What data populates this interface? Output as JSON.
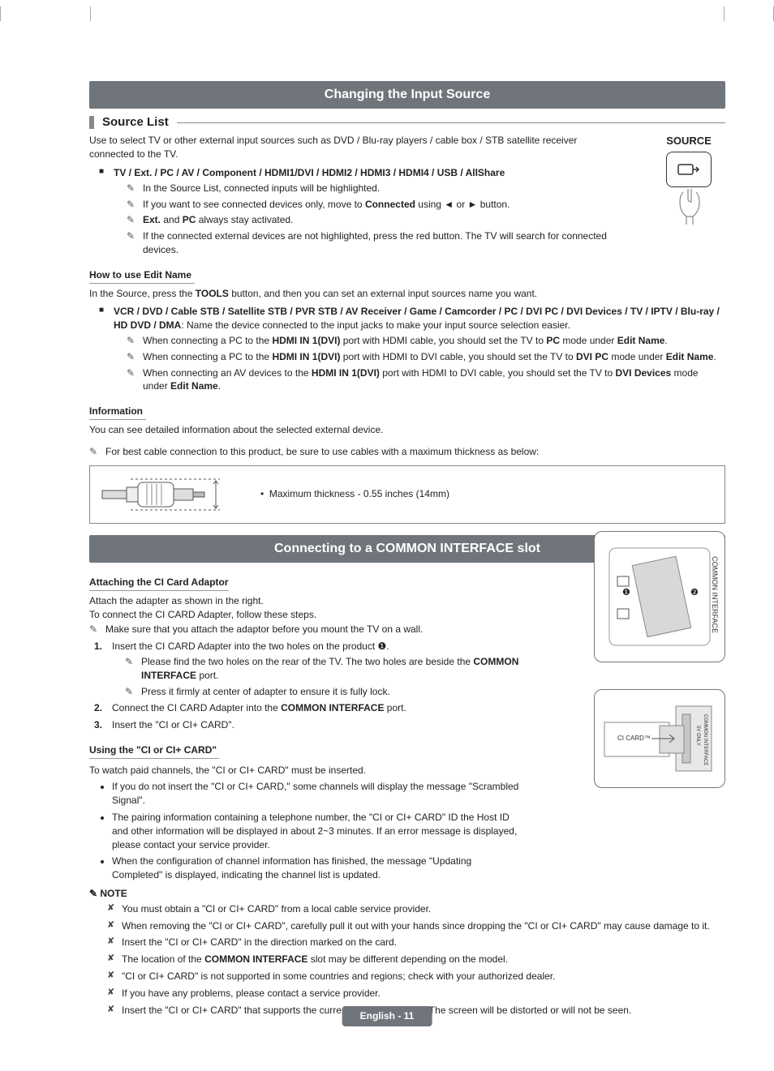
{
  "section1": {
    "bar": "Changing the Input Source",
    "subhead": "Source List",
    "intro": "Use to select TV or other external input sources such as DVD / Blu-ray players / cable box / STB satellite receiver connected to the TV.",
    "sourceLabel": "SOURCE",
    "inputs_line": "TV / Ext. / PC / AV / Component / HDMI1/DVI / HDMI2 / HDMI3 / HDMI4 / USB / AllShare",
    "notes": {
      "n1": "In the Source List, connected inputs will be highlighted.",
      "n2a": "If you want to see connected devices only, move to ",
      "n2b": "Connected",
      "n2c": " using ◄ or ► button.",
      "n3a": "Ext.",
      "n3b": " and ",
      "n3c": "PC",
      "n3d": " always stay activated.",
      "n4": "If the connected external devices are not highlighted, press the red button. The TV will search for connected devices."
    },
    "edit_head": "How to use Edit Name",
    "edit_intro_a": "In the Source, press the ",
    "edit_intro_b": "TOOLS",
    "edit_intro_c": " button, and then you can set an external input sources name you want.",
    "edit_devices_a": "VCR / DVD / Cable STB / Satellite STB / PVR STB / AV Receiver / Game / Camcorder / PC / DVI PC / DVI Devices / TV / IPTV / Blu-ray / HD DVD / DMA",
    "edit_devices_b": ": Name the device connected to the input jacks to make your input source selection easier.",
    "edit_notes": {
      "e1a": "When connecting a PC to the ",
      "e1b": "HDMI IN 1(DVI)",
      "e1c": " port with HDMI cable, you should set the TV to ",
      "e1d": "PC",
      "e1e": " mode under ",
      "e1f": "Edit Name",
      "e1g": ".",
      "e2a": "When connecting a PC to the ",
      "e2b": "HDMI IN 1(DVI)",
      "e2c": " port with HDMI to DVI cable, you should set the TV to ",
      "e2d": "DVI PC",
      "e2e": " mode under ",
      "e2f": "Edit Name",
      "e2g": ".",
      "e3a": "When connecting an AV devices to the ",
      "e3b": "HDMI IN 1(DVI)",
      "e3c": " port with HDMI to DVI cable, you should set the TV to ",
      "e3d": "DVI Devices",
      "e3e": " mode under ",
      "e3f": "Edit Name",
      "e3g": "."
    },
    "info_head": "Information",
    "info_text": "You can see detailed information about the selected external device.",
    "cable_note": "For best cable connection to this product, be sure to use cables with a maximum thickness as below:",
    "cable_spec": "Maximum thickness - 0.55 inches (14mm)"
  },
  "section2": {
    "bar": "Connecting to a COMMON INTERFACE slot",
    "attach_head": "Attaching the CI Card Adaptor",
    "attach_lines": {
      "a1": "Attach the adapter as shown in the right.",
      "a2": "To connect the CI CARD Adapter, follow these steps.",
      "a3": "Make sure that you attach the adaptor before you mount the TV on a wall."
    },
    "steps": {
      "s1": "Insert the CI CARD Adapter into the two holes on the product ❶.",
      "s1_n1a": "Please find the two holes on the rear of the TV. The two holes are beside the ",
      "s1_n1b": "COMMON INTERFACE",
      "s1_n1c": " port.",
      "s1_n2": "Press it firmly at center of adapter to ensure it is fully lock.",
      "s2a": "Connect the CI CARD Adapter into the ",
      "s2b": "COMMON INTERFACE",
      "s2c": " port.",
      "s3": "Insert the \"CI or CI+ CARD\"."
    },
    "using_head": "Using the \"CI or CI+ CARD\"",
    "using_intro": "To watch paid channels, the \"CI or CI+ CARD\" must be inserted.",
    "using_bullets": {
      "b1": "If you do not insert the \"CI or CI+ CARD,\" some channels will display the message \"Scrambled Signal\".",
      "b2": "The pairing information containing a telephone number, the \"CI or CI+ CARD\" ID the Host ID and other information will be displayed in about 2~3 minutes. If an error message is displayed, please contact your service provider.",
      "b3": "When the configuration of channel information has finished, the message \"Updating Completed\" is displayed, indicating the channel list is updated."
    },
    "note_label": "NOTE",
    "note_items": {
      "x1": "You must obtain a \"CI or CI+ CARD\" from a local cable service provider.",
      "x2": "When removing the \"CI or CI+ CARD\", carefully pull it out with your hands since dropping the \"CI or CI+ CARD\" may cause damage to it.",
      "x3": "Insert the \"CI or CI+ CARD\" in the direction marked on the card.",
      "x4a": "The location of the ",
      "x4b": "COMMON INTERFACE",
      "x4c": " slot may be different depending on the model.",
      "x5": "\"CI or CI+ CARD\" is not supported in some countries and regions; check with your authorized dealer.",
      "x6": "If you have any problems, please contact a service provider.",
      "x7": "Insert the \"CI or CI+ CARD\" that supports the current antenna settings. The screen will be distorted or will not be seen."
    },
    "diagram1": {
      "label": "COMMON INTERFACE",
      "mark1": "❶",
      "mark2": "❷"
    },
    "diagram2": {
      "card": "CI CARD™",
      "label": "COMMON INTERFACE",
      "volt": "5V ONLY"
    }
  },
  "footer": "English - 11"
}
